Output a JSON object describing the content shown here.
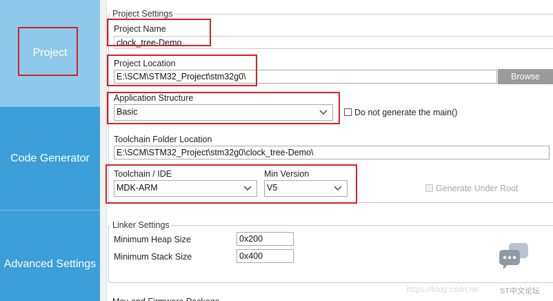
{
  "sidebar": {
    "items": [
      {
        "label": "Project"
      },
      {
        "label": "Code Generator"
      },
      {
        "label": "Advanced Settings"
      }
    ]
  },
  "project_settings": {
    "legend": "Project Settings",
    "project_name_label": "Project Name",
    "project_name_value": "clock_tree-Demo",
    "project_location_label": "Project Location",
    "project_location_value": "E:\\SCM\\STM32_Project\\stm32g0\\",
    "browse_label": "Browse",
    "app_structure_label": "Application Structure",
    "app_structure_value": "Basic",
    "no_main_label": "Do not generate the main()",
    "toolchain_folder_label": "Toolchain Folder Location",
    "toolchain_folder_value": "E:\\SCM\\STM32_Project\\stm32g0\\clock_tree-Demo\\",
    "toolchain_ide_label": "Toolchain / IDE",
    "toolchain_ide_value": "MDK-ARM",
    "min_version_label": "Min Version",
    "min_version_value": "V5",
    "gen_under_root_label": "Generate Under Root"
  },
  "linker_settings": {
    "legend": "Linker Settings",
    "heap_label": "Minimum Heap Size",
    "heap_value": "0x200",
    "stack_label": "Minimum Stack Size",
    "stack_value": "0x400"
  },
  "next_section_legend": "Mcu and Firmware Package",
  "watermark": {
    "url": "https://blog.csdn.ne",
    "brand": "ST中文论坛"
  },
  "colors": {
    "sidebar": "#3b9fd8",
    "sidebar_active": "#8ec9ec",
    "annotation_box": "#d32020",
    "browse_button": "#9a9a9a"
  }
}
